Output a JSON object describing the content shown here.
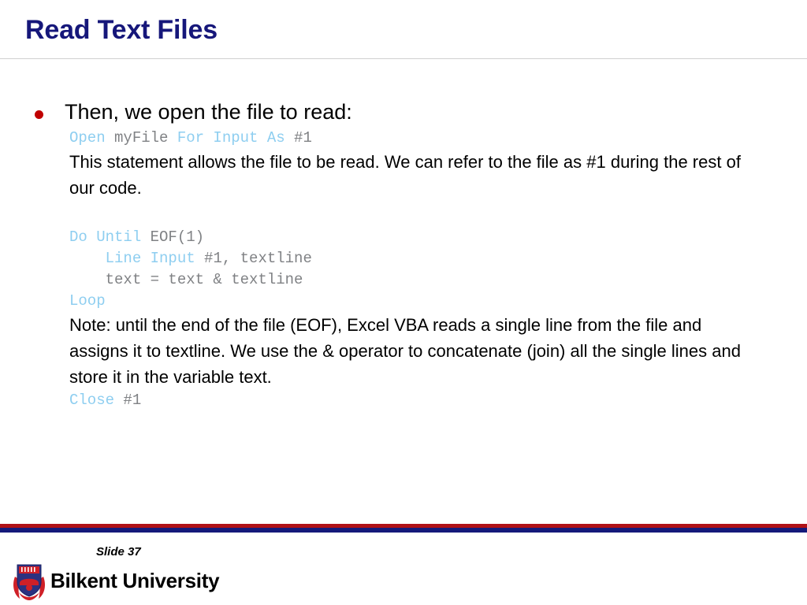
{
  "slide": {
    "title": "Read Text Files",
    "bullet": "Then, we open the file to read:",
    "code_open": {
      "kw1": "Open",
      "id1": " myFile ",
      "kw2": "For Input As",
      "id2": " #1"
    },
    "para1": "This statement allows the file to be read. We can refer to the file as #1 during the rest of our code.",
    "code_loop": {
      "line1_kw": "Do Until",
      "line1_id": " EOF(1)",
      "line2_indent": "    ",
      "line2_kw": "Line Input",
      "line2_id": " #1, textline",
      "line3": "    text = text & textline",
      "line4_kw": "Loop"
    },
    "para2": "Note: until the end of the file (EOF), Excel VBA reads a single line from the file and assigns it to textline. We use the & operator to concatenate (join) all the single lines and store it in the variable text.",
    "code_close": {
      "kw": "Close",
      "id": " #1"
    }
  },
  "footer": {
    "slide_number": "Slide 37",
    "university": "Bilkent University"
  },
  "colors": {
    "title": "#16177a",
    "bullet": "#c00000",
    "keyword": "#8ecef0",
    "identifier": "#808285",
    "bar_red": "#b01116",
    "bar_navy": "#141a7a"
  }
}
